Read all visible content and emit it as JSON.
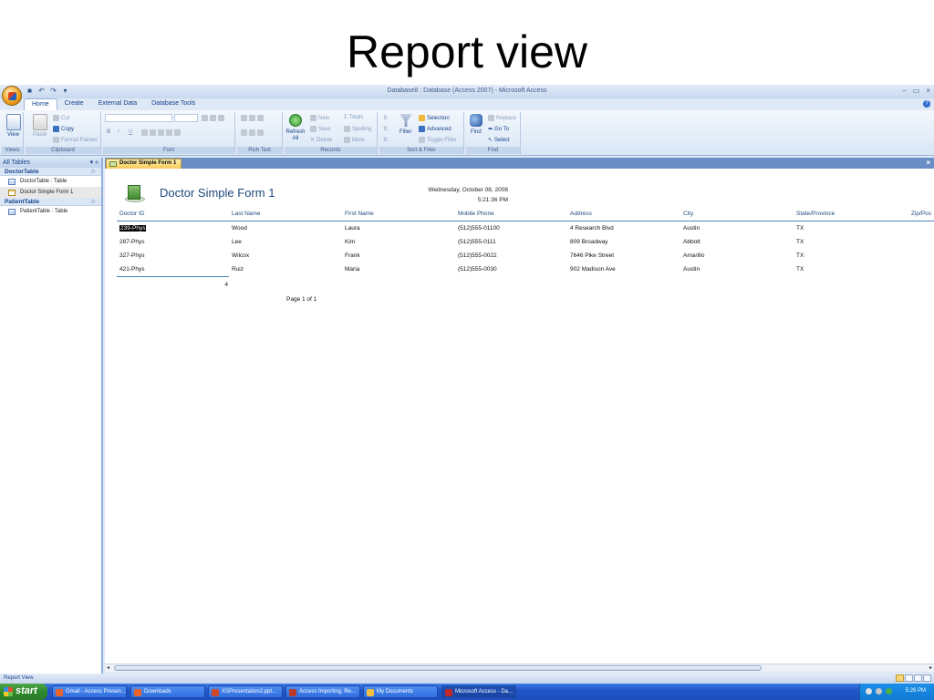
{
  "slide_title": "Report view",
  "window": {
    "title": "Database8 : Database (Access 2007) - Microsoft Access",
    "controls": [
      "–",
      "▭",
      "×"
    ]
  },
  "ribbon": {
    "tabs": [
      "Home",
      "Create",
      "External Data",
      "Database Tools"
    ],
    "groups": {
      "views": {
        "label": "Views",
        "view": "View"
      },
      "clipboard": {
        "label": "Clipboard",
        "paste": "Paste",
        "cut": "Cut",
        "copy": "Copy",
        "format_painter": "Format Painter"
      },
      "font": {
        "label": "Font"
      },
      "rich_text": {
        "label": "Rich Text"
      },
      "records": {
        "label": "Records",
        "refresh": "Refresh All",
        "new": "New",
        "save": "Save",
        "delete": "Delete",
        "totals": "Totals",
        "spelling": "Spelling",
        "more": "More"
      },
      "sort_filter": {
        "label": "Sort & Filter",
        "filter": "Filter",
        "selection": "Selection",
        "advanced": "Advanced",
        "toggle_filter": "Toggle Filter"
      },
      "find": {
        "label": "Find",
        "find": "Find",
        "replace": "Replace",
        "goto": "Go To",
        "select": "Select"
      }
    }
  },
  "nav": {
    "header": "All Tables",
    "groups": [
      {
        "name": "DoctorTable",
        "items": [
          "DoctorTable : Table",
          "Doctor Simple Form 1"
        ]
      },
      {
        "name": "PatientTable",
        "items": [
          "PatientTable : Table"
        ]
      }
    ]
  },
  "doc_tab": "Doctor Simple Form 1",
  "report": {
    "title": "Doctor Simple Form 1",
    "date": "Wednesday, October 08, 2008",
    "time": "5:21:36 PM",
    "columns": [
      "Doctor ID",
      "Last Name",
      "First Name",
      "Mobile Phone",
      "Address",
      "City",
      "State/Province",
      "Zip/Pos"
    ],
    "rows": [
      [
        "239-Phys",
        "Wood",
        "Laura",
        "(512)555-01100",
        "4 Research Blvd",
        "Austin",
        "TX"
      ],
      [
        "287-Phys",
        "Lee",
        "Kim",
        "(512)555-0111",
        "809 Broadway",
        "Abbott",
        "TX"
      ],
      [
        "327-Phys",
        "Wilcox",
        "Frank",
        "(512)555-0022",
        "7646 Pike Street",
        "Amarillo",
        "TX"
      ],
      [
        "421-Phys",
        "Ruiz",
        "Maria",
        "(512)555-0030",
        "902 Madison Ave",
        "Austin",
        "TX"
      ]
    ],
    "count": "4",
    "page": "Page 1 of 1"
  },
  "status": "Report View",
  "taskbar": {
    "start": "start",
    "buttons": [
      {
        "label": "Gmail - Access Presen...",
        "color": "#e8632a"
      },
      {
        "label": "Downloads",
        "color": "#e8632a"
      },
      {
        "label": "XSPresentation2.ppt...",
        "color": "#d04a2a"
      },
      {
        "label": "Access Importing, Re...",
        "color": "#b83a2a"
      },
      {
        "label": "My Documents",
        "color": "#f0c040"
      },
      {
        "label": "Microsoft Access - Da...",
        "color": "#c02a2a"
      }
    ],
    "clock": "5:26 PM"
  }
}
